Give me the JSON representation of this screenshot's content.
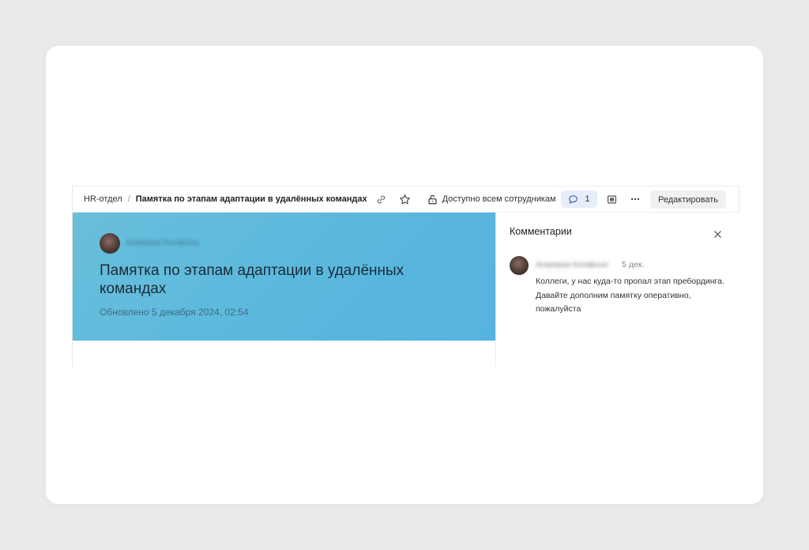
{
  "breadcrumb": {
    "root": "HR-отдел",
    "separator": "/",
    "current": "Памятка по этапам адаптации в удалённых командах"
  },
  "toolbar": {
    "access_label": "Доступно всем сотрудникам",
    "comments_count": "1",
    "edit_label": "Редактировать",
    "icons": [
      "link-icon",
      "star-icon",
      "lock-open-icon",
      "comment-icon",
      "table-of-contents-icon",
      "more-icon"
    ]
  },
  "document": {
    "author": "Anastasia Konakova",
    "title": "Памятка по этапам адаптации в удалённых командах",
    "updated": "Обновлено 5 декабря 2024, 02:54",
    "hero_color": "#5ab8dd"
  },
  "comments_panel": {
    "title": "Комментарии",
    "comments": [
      {
        "author": "Anastasia Konakova",
        "date": "5 дек.",
        "text": "Коллеги, у нас куда-то пропал этап пребординга. Давайте дополним памятку оперативно, пожалуйста"
      }
    ]
  }
}
